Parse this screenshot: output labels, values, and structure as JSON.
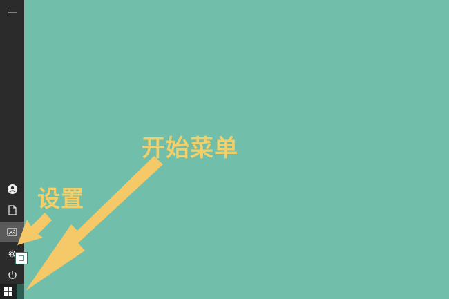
{
  "desktop": {
    "background_color": "#71bfaa"
  },
  "start_menu": {
    "rail_color": "#2b2b2b",
    "items": [
      {
        "name": "menu",
        "icon": "hamburger-icon"
      },
      {
        "name": "account",
        "icon": "user-icon"
      },
      {
        "name": "documents",
        "icon": "document-icon"
      },
      {
        "name": "pictures",
        "icon": "image-icon",
        "active": true
      },
      {
        "name": "settings",
        "icon": "gear-icon"
      },
      {
        "name": "power",
        "icon": "power-icon"
      },
      {
        "name": "start",
        "icon": "windows-logo-icon"
      }
    ]
  },
  "annotations": {
    "start_label": "开始菜单",
    "settings_label": "设置",
    "label_color": "#f3cf69",
    "arrow_color": "#f5c868"
  }
}
